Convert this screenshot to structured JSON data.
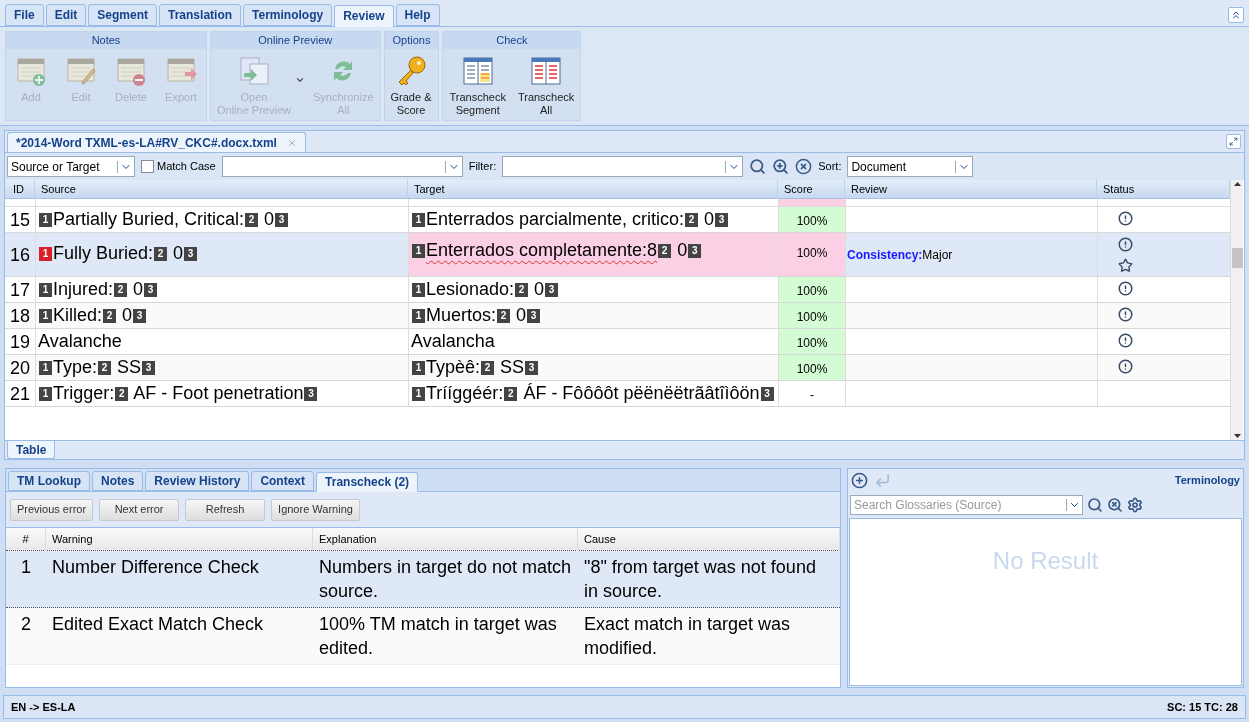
{
  "menu_tabs": [
    {
      "label": "File",
      "selected": false
    },
    {
      "label": "Edit",
      "selected": false
    },
    {
      "label": "Segment",
      "selected": false
    },
    {
      "label": "Translation",
      "selected": false
    },
    {
      "label": "Terminology",
      "selected": false
    },
    {
      "label": "Review",
      "selected": true
    },
    {
      "label": "Help",
      "selected": false
    }
  ],
  "ribbon_groups": [
    {
      "title": "Notes",
      "buttons": [
        {
          "lines": [
            "Add"
          ],
          "disabled": true,
          "dropdown": false
        },
        {
          "lines": [
            "Edit"
          ],
          "disabled": true,
          "dropdown": false
        },
        {
          "lines": [
            "Delete"
          ],
          "disabled": true,
          "dropdown": false
        },
        {
          "lines": [
            "Export"
          ],
          "disabled": true,
          "dropdown": false
        }
      ]
    },
    {
      "title": "Online Preview",
      "buttons": [
        {
          "lines": [
            "Open",
            "Online Preview"
          ],
          "disabled": true,
          "dropdown": true
        },
        {
          "lines": [
            "Synchronize",
            "All"
          ],
          "disabled": true,
          "dropdown": false
        }
      ]
    },
    {
      "title": "Options",
      "buttons": [
        {
          "lines": [
            "Grade &",
            "Score"
          ],
          "disabled": false,
          "dropdown": false
        }
      ]
    },
    {
      "title": "Check",
      "buttons": [
        {
          "lines": [
            "Transcheck",
            "Segment"
          ],
          "disabled": false,
          "dropdown": false
        },
        {
          "lines": [
            "Transcheck",
            "All"
          ],
          "disabled": false,
          "dropdown": false
        }
      ]
    }
  ],
  "document_tab": {
    "title": "*2014-Word TXML-es-LA#RV_CKC#.docx.txml"
  },
  "filter_bar": {
    "scope": "Source or Target",
    "match_case": {
      "label": "Match Case",
      "checked": false
    },
    "filter_label": "Filter:",
    "sort_label": "Sort:",
    "sort": "Document"
  },
  "segments_table": {
    "columns": [
      "ID",
      "Source",
      "Target",
      "Score",
      "Review",
      "Status"
    ],
    "rows": [
      {
        "id": "15",
        "selected": false,
        "target_flagged": false,
        "score": "100%",
        "score_matched": true,
        "source": [
          {
            "kind": "tag",
            "text": "1",
            "error": false
          },
          {
            "kind": "text",
            "text": "Partially Buried, Critical:"
          },
          {
            "kind": "tag",
            "text": "2",
            "error": false
          },
          {
            "kind": "text",
            "text": " 0"
          },
          {
            "kind": "tag",
            "text": "3",
            "error": false
          }
        ],
        "target": [
          {
            "kind": "tag",
            "text": "1",
            "error": false
          },
          {
            "kind": "text",
            "text": "Enterrados parcialmente, critico:"
          },
          {
            "kind": "tag",
            "text": "2",
            "error": false
          },
          {
            "kind": "text",
            "text": " 0"
          },
          {
            "kind": "tag",
            "text": "3",
            "error": false
          }
        ],
        "warning": true,
        "starred": false
      },
      {
        "id": "16",
        "selected": true,
        "target_flagged": true,
        "score": "100%",
        "source": [
          {
            "kind": "tag",
            "text": "1",
            "error": true
          },
          {
            "kind": "text",
            "text": "Fully Buried:"
          },
          {
            "kind": "tag",
            "text": "2",
            "error": false
          },
          {
            "kind": "text",
            "text": " 0"
          },
          {
            "kind": "tag",
            "text": "3",
            "error": false
          }
        ],
        "target": [
          {
            "kind": "tag",
            "text": "1",
            "error": false
          },
          {
            "kind": "text",
            "text": "Enterrados completamente:8",
            "spell_error": true
          },
          {
            "kind": "tag",
            "text": "2",
            "error": false
          },
          {
            "kind": "text",
            "text": " 0"
          },
          {
            "kind": "tag",
            "text": "3",
            "error": false
          }
        ],
        "review": {
          "category": "Consistency:",
          "severity": "Major"
        },
        "warning": true,
        "starred": true
      },
      {
        "id": "17",
        "selected": false,
        "target_flagged": false,
        "score": "100%",
        "score_matched": true,
        "source": [
          {
            "kind": "tag",
            "text": "1",
            "error": false
          },
          {
            "kind": "text",
            "text": "Injured:"
          },
          {
            "kind": "tag",
            "text": "2",
            "error": false
          },
          {
            "kind": "text",
            "text": " 0"
          },
          {
            "kind": "tag",
            "text": "3",
            "error": false
          }
        ],
        "target": [
          {
            "kind": "tag",
            "text": "1",
            "error": false
          },
          {
            "kind": "text",
            "text": "Lesionado:"
          },
          {
            "kind": "tag",
            "text": "2",
            "error": false
          },
          {
            "kind": "text",
            "text": " 0"
          },
          {
            "kind": "tag",
            "text": "3",
            "error": false
          }
        ],
        "warning": true,
        "starred": false
      },
      {
        "id": "18",
        "selected": false,
        "target_flagged": false,
        "score": "100%",
        "score_matched": true,
        "source": [
          {
            "kind": "tag",
            "text": "1",
            "error": false
          },
          {
            "kind": "text",
            "text": "Killed:"
          },
          {
            "kind": "tag",
            "text": "2",
            "error": false
          },
          {
            "kind": "text",
            "text": " 0"
          },
          {
            "kind": "tag",
            "text": "3",
            "error": false
          }
        ],
        "target": [
          {
            "kind": "tag",
            "text": "1",
            "error": false
          },
          {
            "kind": "text",
            "text": "Muertos:"
          },
          {
            "kind": "tag",
            "text": "2",
            "error": false
          },
          {
            "kind": "text",
            "text": " 0"
          },
          {
            "kind": "tag",
            "text": "3",
            "error": false
          }
        ],
        "warning": true,
        "starred": false
      },
      {
        "id": "19",
        "selected": false,
        "target_flagged": false,
        "score": "100%",
        "score_matched": true,
        "source": [
          {
            "kind": "text",
            "text": "Avalanche"
          }
        ],
        "target": [
          {
            "kind": "text",
            "text": "Avalancha"
          }
        ],
        "warning": true,
        "starred": false
      },
      {
        "id": "20",
        "selected": false,
        "target_flagged": false,
        "score": "100%",
        "score_matched": true,
        "source": [
          {
            "kind": "tag",
            "text": "1",
            "error": false
          },
          {
            "kind": "text",
            "text": "Type:"
          },
          {
            "kind": "tag",
            "text": "2",
            "error": false
          },
          {
            "kind": "text",
            "text": " SS"
          },
          {
            "kind": "tag",
            "text": "3",
            "error": false
          }
        ],
        "target": [
          {
            "kind": "tag",
            "text": "1",
            "error": false
          },
          {
            "kind": "text",
            "text": "Typèê:"
          },
          {
            "kind": "tag",
            "text": "2",
            "error": false
          },
          {
            "kind": "text",
            "text": " SS"
          },
          {
            "kind": "tag",
            "text": "3",
            "error": false
          }
        ],
        "warning": true,
        "starred": false
      },
      {
        "id": "21",
        "selected": false,
        "target_flagged": false,
        "score": "-",
        "score_matched": false,
        "source": [
          {
            "kind": "tag",
            "text": "1",
            "error": false
          },
          {
            "kind": "text",
            "text": "Trigger:"
          },
          {
            "kind": "tag",
            "text": "2",
            "error": false
          },
          {
            "kind": "text",
            "text": " AF - Foot penetration"
          },
          {
            "kind": "tag",
            "text": "3",
            "error": false
          }
        ],
        "target": [
          {
            "kind": "tag",
            "text": "1",
            "error": false
          },
          {
            "kind": "text",
            "text": "Trííggéér:"
          },
          {
            "kind": "tag",
            "text": "2",
            "error": false
          },
          {
            "kind": "text",
            "text": " ÁF - Fôôôôt pëënëëtrãâtîìôön"
          },
          {
            "kind": "tag",
            "text": "3",
            "error": false
          }
        ],
        "warning": false,
        "starred": false
      }
    ]
  },
  "view_tabs": [
    {
      "label": "Table",
      "selected": true
    }
  ],
  "bottom_tabs": [
    {
      "label": "TM Lookup",
      "selected": false
    },
    {
      "label": "Notes",
      "selected": false
    },
    {
      "label": "Review History",
      "selected": false
    },
    {
      "label": "Context",
      "selected": false
    },
    {
      "label": "Transcheck (2)",
      "selected": true
    }
  ],
  "transcheck": {
    "buttons": [
      "Previous error",
      "Next error",
      "Refresh",
      "Ignore Warning"
    ],
    "columns": [
      "#",
      "Warning",
      "Explanation",
      "Cause"
    ],
    "rows": [
      {
        "number": "1",
        "warning": "Number Difference Check",
        "explanation": "Numbers in target do not match source.",
        "cause": "\"8\" from target was not found in source.",
        "selected": true
      },
      {
        "number": "2",
        "warning": "Edited Exact Match Check",
        "explanation": "100% TM match in target was edited.",
        "cause": "Exact match in target was modified.",
        "selected": false
      }
    ]
  },
  "terminology": {
    "title": "Terminology",
    "search_placeholder": "Search Glossaries (Source)",
    "empty_message": "No Result"
  },
  "status_bar": {
    "languages": "EN -> ES-LA",
    "counts": "SC: 15 TC: 28"
  }
}
